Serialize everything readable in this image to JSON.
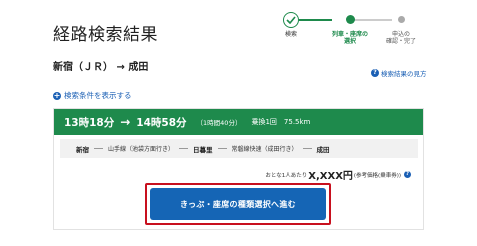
{
  "page": {
    "title": "経路検索結果"
  },
  "stepper": {
    "steps": [
      {
        "label": "検索",
        "state": "done"
      },
      {
        "label": "列車・座席の\n選択",
        "state": "current"
      },
      {
        "label": "申込の\n確認・完了",
        "state": "upcoming"
      }
    ]
  },
  "route": {
    "title": "新宿（ＪＲ） → 成田"
  },
  "links": {
    "help": "検索結果の見方",
    "conditions": "検索条件を表示する"
  },
  "result": {
    "depart_time": "13時18分",
    "arrive_time": "14時58分",
    "duration": "（1時間40分）",
    "transfers": "乗換1回",
    "distance": "75.5km",
    "segments": [
      {
        "type": "station",
        "text": "新宿"
      },
      {
        "type": "line",
        "text": "山手線（池袋方面行き）"
      },
      {
        "type": "station",
        "text": "日暮里"
      },
      {
        "type": "line",
        "text": "常磐線快速（成田行き）"
      },
      {
        "type": "station",
        "text": "成田"
      }
    ],
    "fare_prefix": "おとな1人あたり",
    "fare_value": "X,XXX円",
    "fare_suffix": "(参考価格(乗車券))"
  },
  "cta": {
    "label": "きっぷ・座席の種類選択へ進む"
  },
  "colors": {
    "accent_green": "#1e8a4c",
    "link_blue": "#1a5fb4",
    "cta_blue": "#1565b5",
    "highlight_red": "#c8101e"
  }
}
